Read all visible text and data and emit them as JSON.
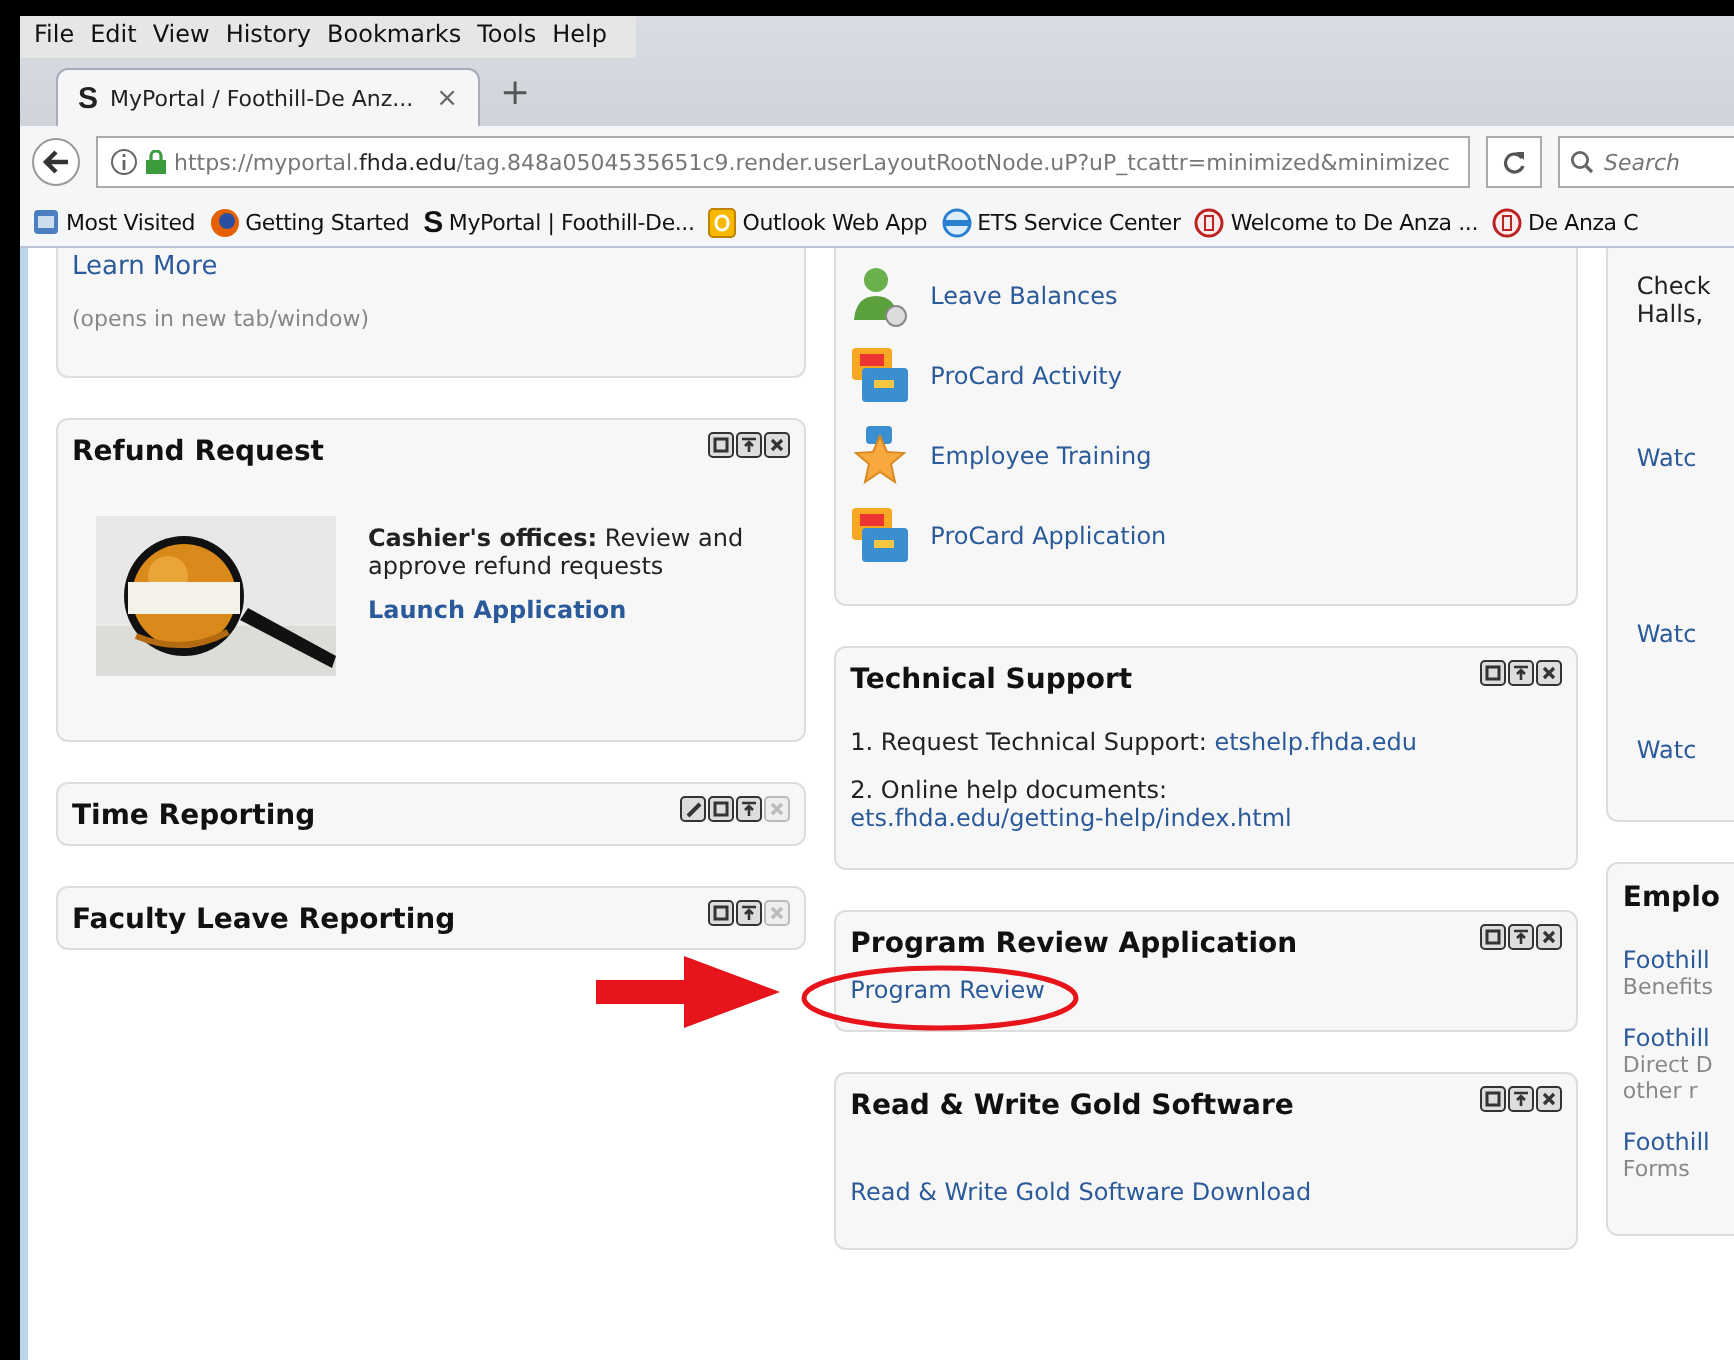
{
  "menu_bar": [
    "File",
    "Edit",
    "View",
    "History",
    "Bookmarks",
    "Tools",
    "Help"
  ],
  "tabs": [
    {
      "icon_text": "S",
      "title": "MyPortal / Foothill-De Anz...",
      "close": "×",
      "selected": true
    }
  ],
  "new_tab": "+",
  "address_bar": {
    "url": "https://myportal.**fhda.edu**/tag.848a0504535651c9.render.userLayoutRootNode.uP?uP_tcattr=minimized&minimizec"
  },
  "search": {
    "placeholder": "Search"
  },
  "bookmarks": [
    {
      "kind": "folder",
      "label": "Most Visited"
    },
    {
      "kind": "browser",
      "label": "Getting Started"
    },
    {
      "kind": "letter",
      "icon_text": "S",
      "label": "MyPortal | Foothill-De..."
    },
    {
      "kind": "mail",
      "label": "Outlook Web App"
    },
    {
      "kind": "globe",
      "label": "ETS Service Center"
    },
    {
      "kind": "seal",
      "label": "Welcome to De Anza ..."
    },
    {
      "kind": "seal",
      "label": "De Anza C"
    }
  ],
  "columns": [
    [
      {
        "kind": "learn_more",
        "link": "Learn More",
        "note": "(opens in new tab/window)"
      },
      {
        "kind": "image_text",
        "title": "Refund Request",
        "controls": [
          {
            "kind": "minimize",
            "disabled": false
          },
          {
            "kind": "maximize",
            "disabled": false
          },
          {
            "kind": "close",
            "disabled": false
          }
        ],
        "description": "**Cashier's offices:** Review and approve refund requests",
        "link": "Launch Application"
      },
      {
        "kind": "header_only",
        "title": "Time Reporting",
        "controls": [
          {
            "kind": "edit",
            "disabled": false
          },
          {
            "kind": "minimize",
            "disabled": false
          },
          {
            "kind": "maximize",
            "disabled": false
          },
          {
            "kind": "close",
            "disabled": true
          }
        ]
      },
      {
        "kind": "header_only",
        "title": "Faculty Leave Reporting",
        "controls": [
          {
            "kind": "minimize",
            "disabled": false
          },
          {
            "kind": "maximize",
            "disabled": false
          },
          {
            "kind": "close",
            "disabled": true
          }
        ]
      }
    ],
    [
      {
        "kind": "app_list",
        "items": [
          {
            "kind": "person",
            "label": "Leave Balances"
          },
          {
            "kind": "card",
            "label": "ProCard Activity"
          },
          {
            "kind": "star",
            "label": "Employee Training"
          },
          {
            "kind": "card",
            "label": "ProCard Application"
          }
        ]
      },
      {
        "kind": "numbered_links",
        "title": "Technical Support",
        "controls": [
          {
            "kind": "minimize",
            "disabled": false
          },
          {
            "kind": "maximize",
            "disabled": false
          },
          {
            "kind": "close",
            "disabled": false
          }
        ],
        "items": [
          {
            "text": "1. Request Technical Support:",
            "link": "etshelp.fhda.edu"
          },
          {
            "text": "2. Online help documents:",
            "link": "ets.fhda.edu/getting-help/index.html"
          }
        ]
      },
      {
        "kind": "single_link",
        "title": "Program Review Application",
        "controls": [
          {
            "kind": "minimize",
            "disabled": false
          },
          {
            "kind": "maximize",
            "disabled": false
          },
          {
            "kind": "close",
            "disabled": false
          }
        ],
        "link": "Program Review",
        "annotation_arrow": true,
        "annotation_ellipse": true
      },
      {
        "kind": "download_link",
        "title": "Read & Write Gold Software",
        "controls": [
          {
            "kind": "minimize",
            "disabled": false
          },
          {
            "kind": "maximize",
            "disabled": false
          },
          {
            "kind": "close",
            "disabled": false
          }
        ],
        "link": "Read & Write Gold Software Download"
      }
    ],
    [
      {
        "kind": "cut_text",
        "lines": [
          "Check",
          "Halls,"
        ],
        "links": [
          "Watc",
          "Watc",
          "Watc"
        ]
      },
      {
        "kind": "cut_list",
        "title": "Emplo",
        "items": [
          {
            "link": "Foothill",
            "lines": [
              "Benefits"
            ]
          },
          {
            "link": "Foothill",
            "lines": [
              "Direct D",
              "other r"
            ]
          },
          {
            "link": "Foothill",
            "lines": [
              "Forms"
            ]
          }
        ]
      }
    ]
  ]
}
